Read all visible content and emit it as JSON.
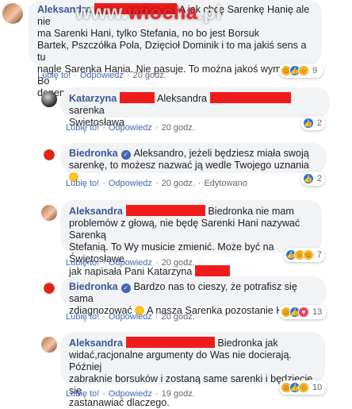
{
  "watermark": {
    "pre": "www.",
    "brand": "wiocha",
    "dot": ".",
    "tld": "pl"
  },
  "comments": [
    {
      "author": "Aleksandra",
      "line1": "A jak chcę Sarenkę Hanię ale nie",
      "line2": "ma Sarenki Hani, tylko Stefania, no bo jest Borsuk",
      "line3": "Bartek, Pszczółka Pola, Dzięcioł Dominik i to ma jakiś sens a tu",
      "line4": "nagle Sarenka Hania. Nie pasuje. To można jakoś wymienić? Bo",
      "line5": "denerwuje mnie to imię Sarenki",
      "like": "Lubię to!",
      "reply": "Odpowiedz",
      "time": "20 godz.",
      "reaction_count": "9"
    },
    {
      "author": "Katarzyna",
      "mid": "Aleksandra",
      "tail": "sarenka",
      "line2": "Swietosława",
      "like": "Lubię to!",
      "reply": "Odpowiedz",
      "time": "20 godz.",
      "reaction_count": "2"
    },
    {
      "author": "Biedronka",
      "line1": "Aleksandro, jeżeli będziesz miała swoją",
      "line2": "sarenkę, to możesz nazwać ją wedle Twojego uznania",
      "like": "Lubię to!",
      "reply": "Odpowiedz",
      "time": "20 godz.",
      "edited": "Edytowano",
      "reaction_count": "2"
    },
    {
      "author": "Aleksandra",
      "tail": "Biedronka nie mam",
      "line2": "problemów z głową, nie będę Sarenki Hani nazywać Sarenką",
      "line3": "Stefanią. To Wy musicie zmienić. Może być na Świętosławe",
      "line4": "jak napisała Pani Katarzyna",
      "like": "Lubię to!",
      "reply": "Odpowiedz",
      "time": "20 godz.",
      "reaction_count": "7"
    },
    {
      "author": "Biedronka",
      "line1": "Bardzo nas to cieszy, że potrafisz się sama",
      "line2": "zdiagnozować",
      "line2b": "A nasza Sarenka pozostanie Hanią",
      "like": "Lubię to!",
      "reply": "Odpowiedz",
      "time": "20 godz.",
      "reaction_count": "13"
    },
    {
      "author": "Aleksandra",
      "tail": "Biedronka jak",
      "line2": "widać,racjonalne argumenty do Was nie docierają. Później",
      "line3": "zabraknie borsuków i zostaną same sarenki i będziecie się",
      "line4": "zastanawiać dlaczego.",
      "like": "Lubię to!",
      "reply": "Odpowiedz",
      "time": "19 godz.",
      "reaction_count": "10"
    }
  ],
  "colors": {
    "link": "#385898",
    "redaction": "#ee1c1c",
    "bubble": "#f2f3f5",
    "brand_red": "#e8282b"
  }
}
